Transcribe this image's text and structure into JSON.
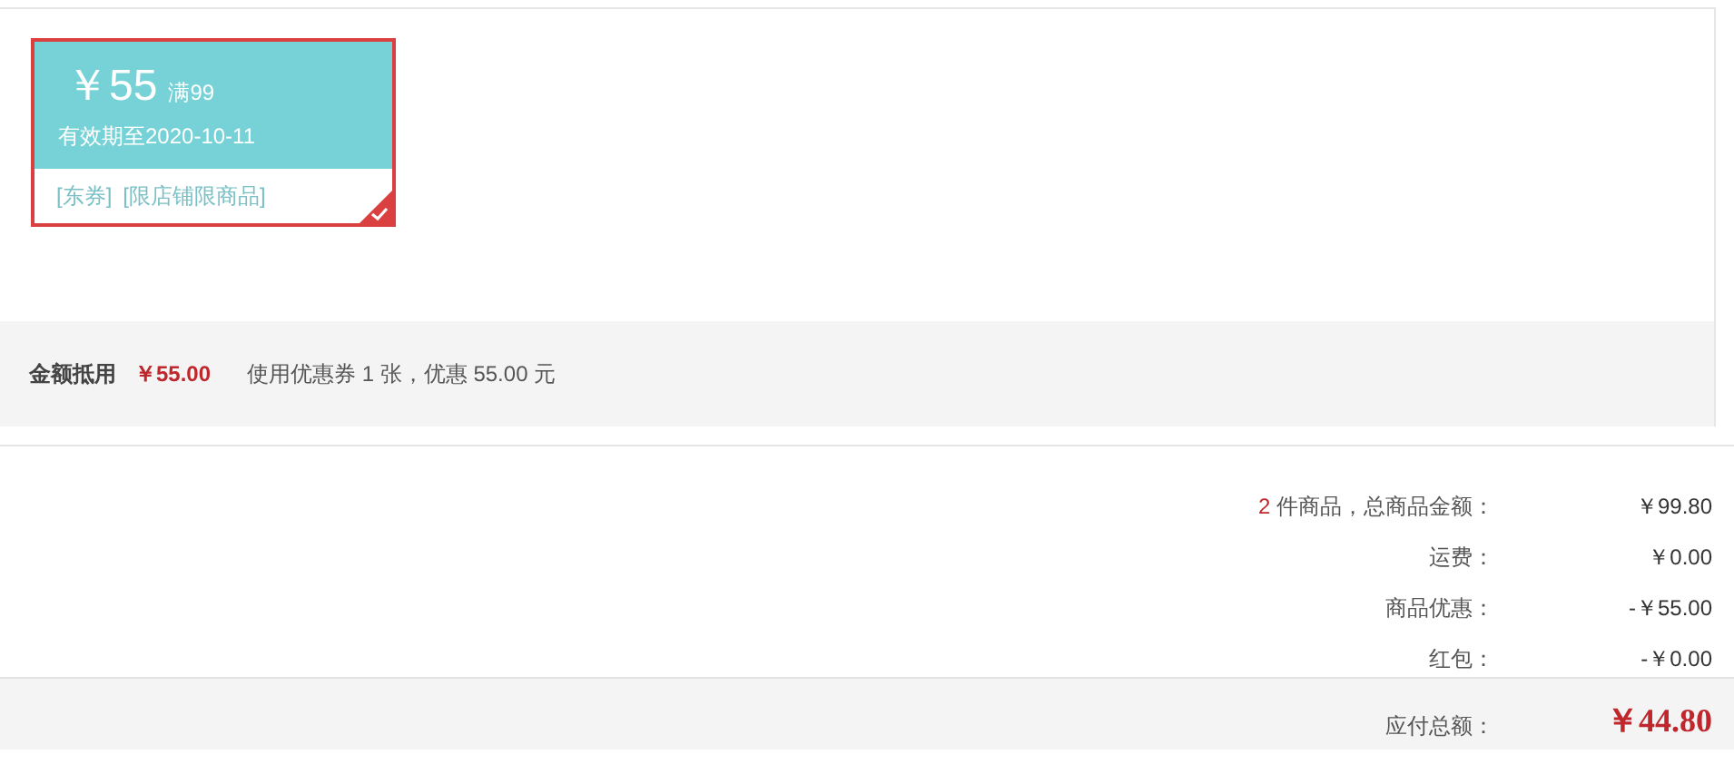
{
  "coupons": [
    {
      "amount": "￥55",
      "condition": "满99",
      "validity": "有效期至2020-10-11",
      "tags": [
        "[东券]",
        "[限店铺限商品]"
      ],
      "selected": true
    }
  ],
  "discount_bar": {
    "label": "金额抵用",
    "amount": "￥55.00",
    "summary": "使用优惠券 1 张，优惠 55.00 元"
  },
  "totals": [
    {
      "count": "2",
      "label": " 件商品，总商品金额：",
      "value": "￥99.80"
    },
    {
      "label": "运费：",
      "value": "￥0.00"
    },
    {
      "label": "商品优惠：",
      "value": "-￥55.00"
    },
    {
      "label": "红包：",
      "value": "-￥0.00"
    }
  ],
  "grand_total": {
    "label": "应付总额：",
    "value": "￥44.80"
  }
}
